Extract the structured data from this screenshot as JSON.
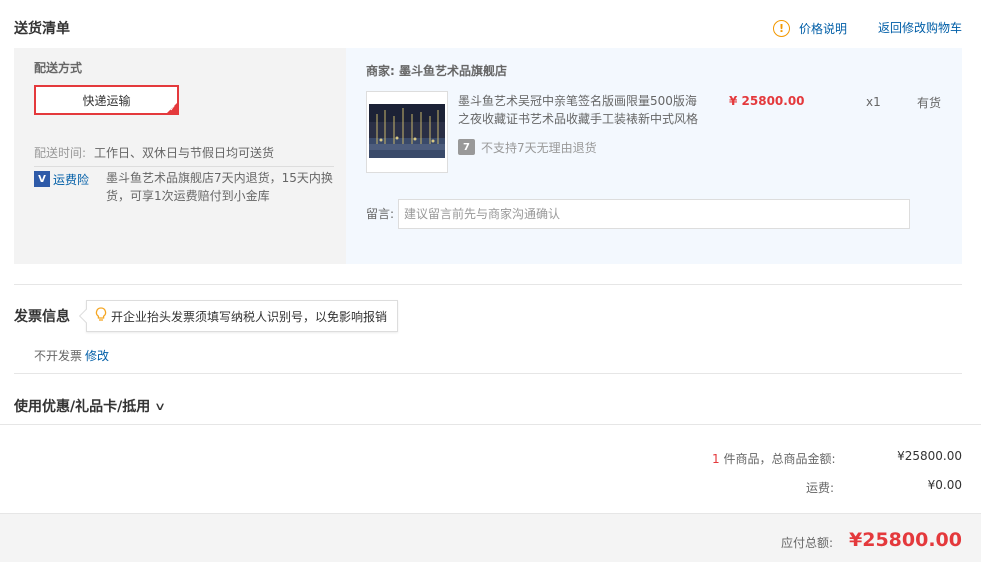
{
  "header": {
    "title": "送货清单",
    "price_note": "价格说明",
    "back_to_cart": "返回修改购物车"
  },
  "shipping": {
    "method_label": "配送方式",
    "method_selected": "快递运输",
    "time_label": "配送时间:",
    "time_value": "工作日、双休日与节假日均可送货",
    "insurance_icon": "V",
    "insurance_label": "运费险",
    "insurance_desc": "墨斗鱼艺术品旗舰店7天内退货，15天内换货，可享1次运费赔付到小金库"
  },
  "merchant": {
    "label": "商家: 墨斗鱼艺术品旗舰店",
    "product": {
      "title": "墨斗鱼艺术吴冠中亲笔签名版画限量500版海之夜收藏证书艺术品收藏手工装裱新中式风格",
      "price": "¥ 25800.00",
      "qty": "x1",
      "stock": "有货",
      "no_return_icon": "7",
      "no_return_text": "不支持7天无理由退货"
    },
    "message_label": "留言:",
    "message_placeholder": "建议留言前先与商家沟通确认"
  },
  "invoice": {
    "title": "发票信息",
    "tip": "开企业抬头发票须填写纳税人识别号，以免影响报销",
    "status": "不开发票",
    "edit": "修改"
  },
  "coupons": {
    "title": "使用优惠/礼品卡/抵用",
    "chevron": "∨"
  },
  "summary": {
    "count": "1",
    "count_text": " 件商品，总商品金额:",
    "amount": "¥25800.00",
    "shipping_label": "运费:",
    "shipping_value": "¥0.00",
    "payable_label": "应付总额:",
    "payable_value": "¥25800.00"
  },
  "colors": {
    "accent_red": "#e4393c",
    "link_blue": "#005ea7",
    "warn_orange": "#f39800"
  },
  "icons": [
    "exclamation-circle-icon",
    "insurance-shield-icon",
    "no-7day-return-icon",
    "lightbulb-icon",
    "chevron-down-icon",
    "selected-check-icon"
  ]
}
